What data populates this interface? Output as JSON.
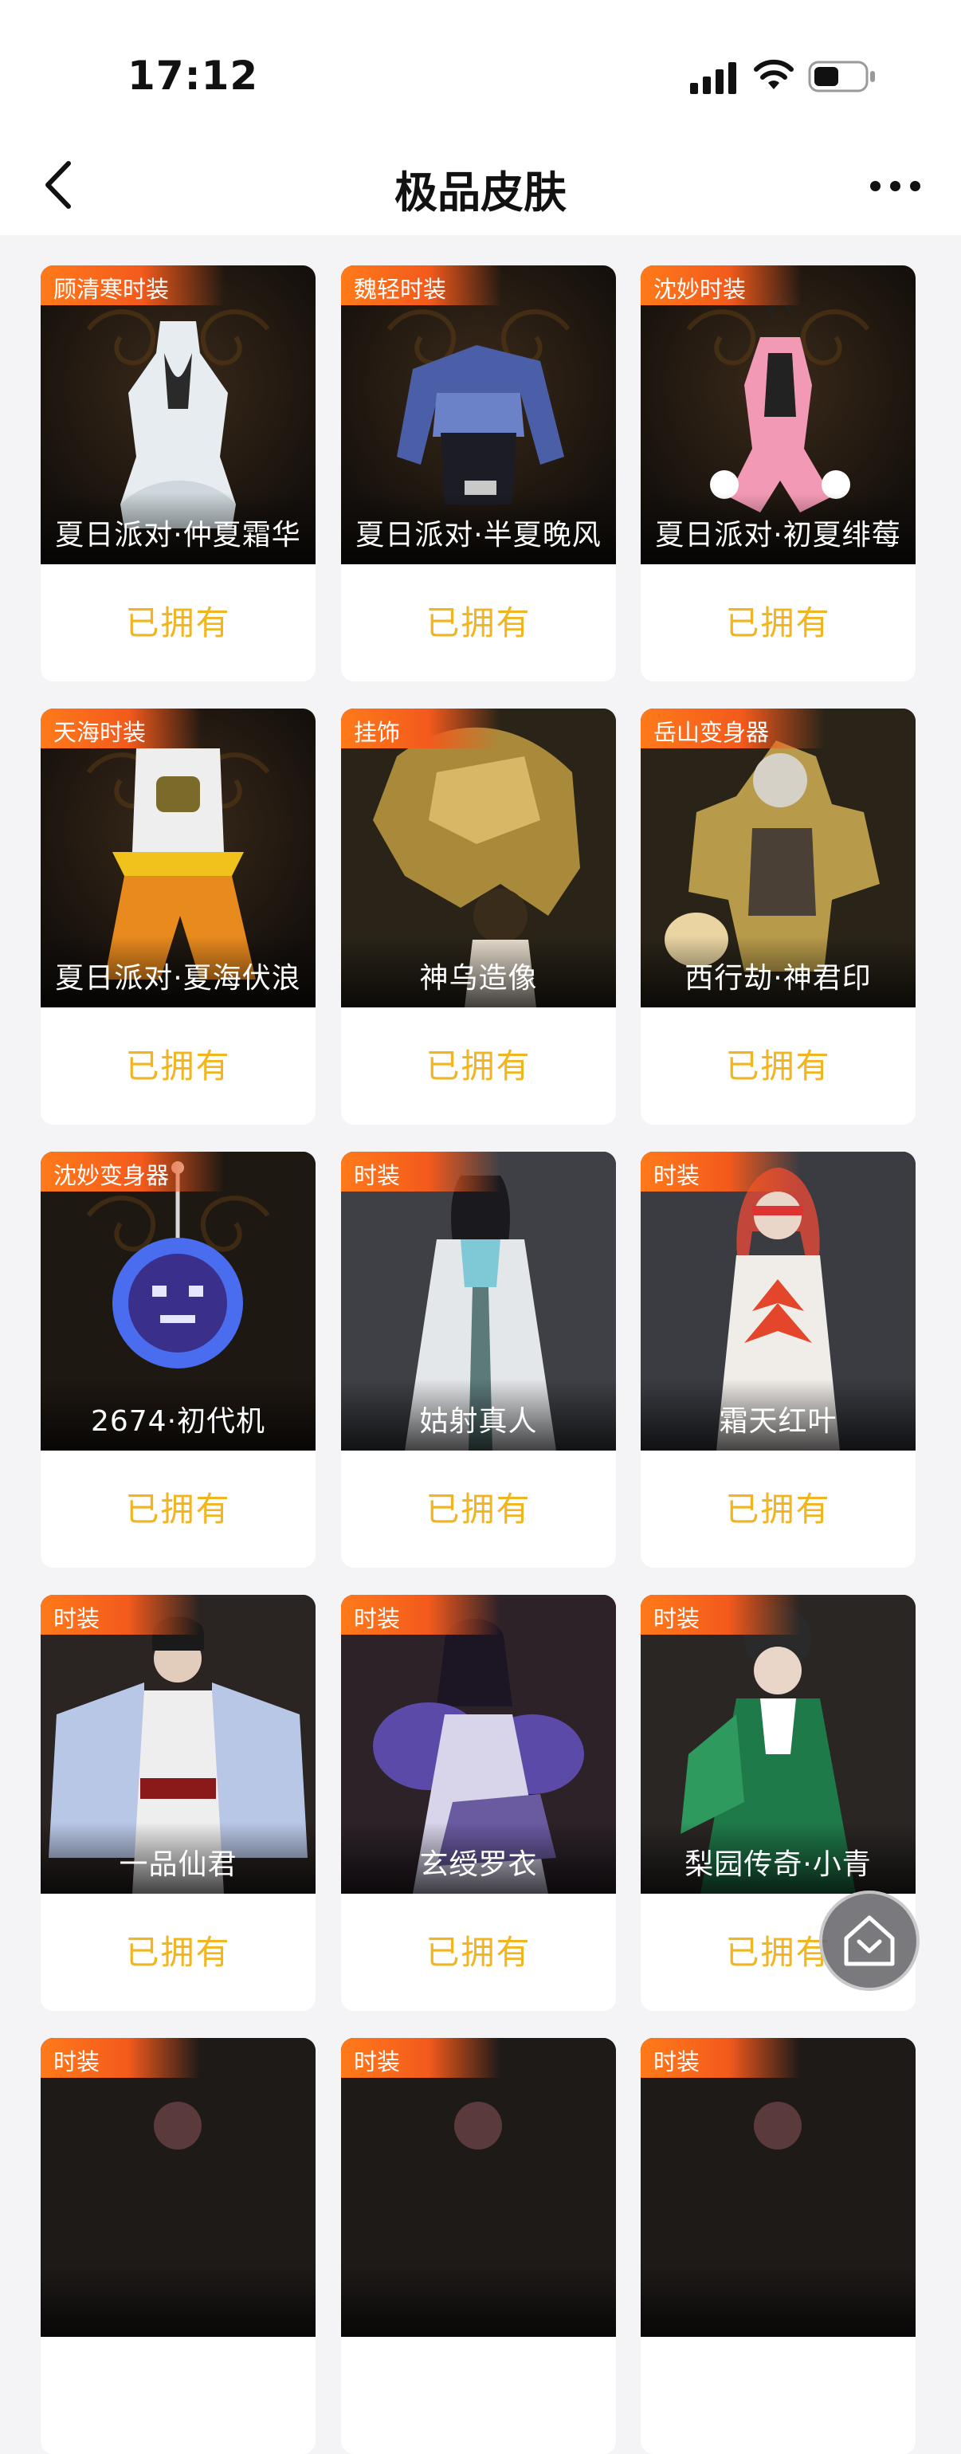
{
  "status_bar": {
    "time": "17:12"
  },
  "nav": {
    "title": "极品皮肤"
  },
  "items": [
    {
      "tag": "顾清寒时装",
      "name": "夏日派对·仲夏霜华",
      "status": "已拥有",
      "theme": "white-dress"
    },
    {
      "tag": "魏轻时装",
      "name": "夏日派对·半夏晚风",
      "status": "已拥有",
      "theme": "blue-top"
    },
    {
      "tag": "沈妙时装",
      "name": "夏日派对·初夏绯莓",
      "status": "已拥有",
      "theme": "pink-dress"
    },
    {
      "tag": "天海时装",
      "name": "夏日派对·夏海伏浪",
      "status": "已拥有",
      "theme": "orange-outfit"
    },
    {
      "tag": "挂饰",
      "name": "神乌造像",
      "status": "已拥有",
      "theme": "golden-statue"
    },
    {
      "tag": "岳山变身器",
      "name": "西行劫·神君印",
      "status": "已拥有",
      "theme": "golden-warrior"
    },
    {
      "tag": "沈妙变身器",
      "name": "2674·初代机",
      "status": "已拥有",
      "theme": "pendant"
    },
    {
      "tag": "时装",
      "name": "姑射真人",
      "status": "已拥有",
      "theme": "white-robe"
    },
    {
      "tag": "时装",
      "name": "霜天红叶",
      "status": "已拥有",
      "theme": "red-leaf"
    },
    {
      "tag": "时装",
      "name": "一品仙君",
      "status": "已拥有",
      "theme": "feather-robe"
    },
    {
      "tag": "时装",
      "name": "玄绶罗衣",
      "status": "已拥有",
      "theme": "purple-fur"
    },
    {
      "tag": "时装",
      "name": "梨园传奇·小青",
      "status": "已拥有",
      "theme": "green-opera"
    },
    {
      "tag": "时装",
      "name": "",
      "status": "",
      "theme": "dark"
    },
    {
      "tag": "时装",
      "name": "",
      "status": "",
      "theme": "dark"
    },
    {
      "tag": "时装",
      "name": "",
      "status": "",
      "theme": "dark"
    }
  ]
}
